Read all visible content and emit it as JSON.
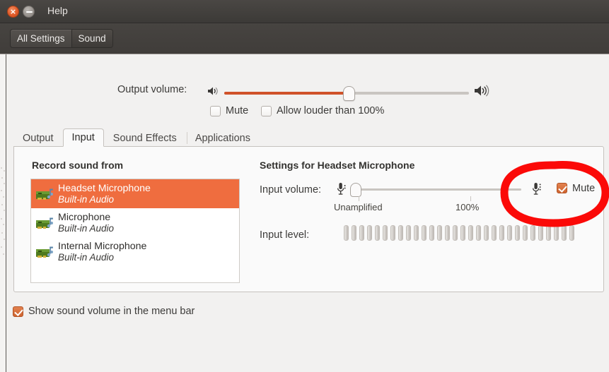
{
  "window": {
    "title": "Help",
    "close_icon": "close-icon",
    "minimize_icon": "minimize-icon",
    "close_glyph": "×"
  },
  "toolbar": {
    "breadcrumbs": [
      {
        "label": "All Settings",
        "active": false
      },
      {
        "label": "Sound",
        "active": true
      }
    ]
  },
  "output": {
    "volume_label": "Output volume:",
    "volume_percent": 51,
    "speaker_low_icon": "speaker-low-icon",
    "speaker_high_icon": "speaker-high-icon",
    "mute_label": "Mute",
    "mute_checked": false,
    "allow_louder_label": "Allow louder than 100%",
    "allow_louder_checked": false
  },
  "tabs": [
    {
      "label": "Output",
      "active": false
    },
    {
      "label": "Input",
      "active": true
    },
    {
      "label": "Sound Effects",
      "active": false
    },
    {
      "label": "Applications",
      "active": false
    }
  ],
  "input_tab": {
    "list_header": "Record sound from",
    "settings_header": "Settings for Headset Microphone",
    "devices": [
      {
        "name": "Headset Microphone",
        "subtitle": "Built-in Audio",
        "selected": true,
        "icon": "sound-card-icon"
      },
      {
        "name": "Microphone",
        "subtitle": "Built-in Audio",
        "selected": false,
        "icon": "sound-card-icon"
      },
      {
        "name": "Internal Microphone",
        "subtitle": "Built-in Audio",
        "selected": false,
        "icon": "sound-card-icon"
      }
    ],
    "input_volume_label": "Input volume:",
    "input_volume_percent": 0,
    "mic_low_icon": "microphone-low-icon",
    "mic_high_icon": "microphone-high-icon",
    "tick_unamplified": "Unamplified",
    "tick_hundred": "100%",
    "mute_label": "Mute",
    "mute_checked": true,
    "input_level_label": "Input level:",
    "input_level_segments": 30,
    "input_level_active": 0
  },
  "footer": {
    "show_volume_label": "Show sound volume in the menu bar",
    "show_volume_checked": true
  },
  "annotation": {
    "shape": "red-ellipse-highlight",
    "color": "#FB0A08",
    "target": "Mute checkbox"
  },
  "colors": {
    "selection_orange": "#EF6D3F",
    "slider_orange": "#D0522A",
    "titlebar": "#413E3B",
    "panel": "#F2F1F0",
    "annotation_red": "#FB0A08"
  }
}
